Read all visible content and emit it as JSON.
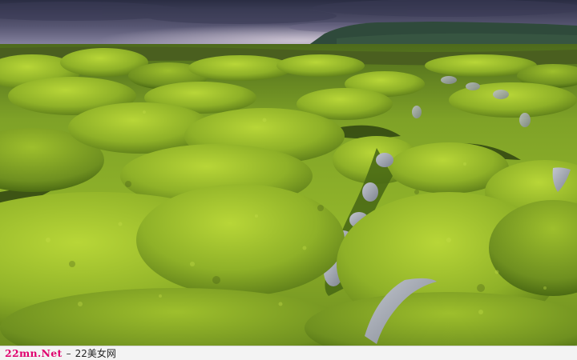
{
  "watermark": {
    "domain": "22mn.Net",
    "separator": "–",
    "site_name": "22美女网"
  },
  "colors": {
    "sky_top": "#2e3147",
    "sky_mid": "#5c5c78",
    "sky_glow": "#b9aec3",
    "mountain": "#2f4a3b",
    "moss_bright": "#a9cb2c",
    "moss_mid": "#7ea021",
    "moss_dark": "#3f5a12",
    "rock_grey": "#9aa0aa",
    "caption_accent": "#e0006e"
  }
}
